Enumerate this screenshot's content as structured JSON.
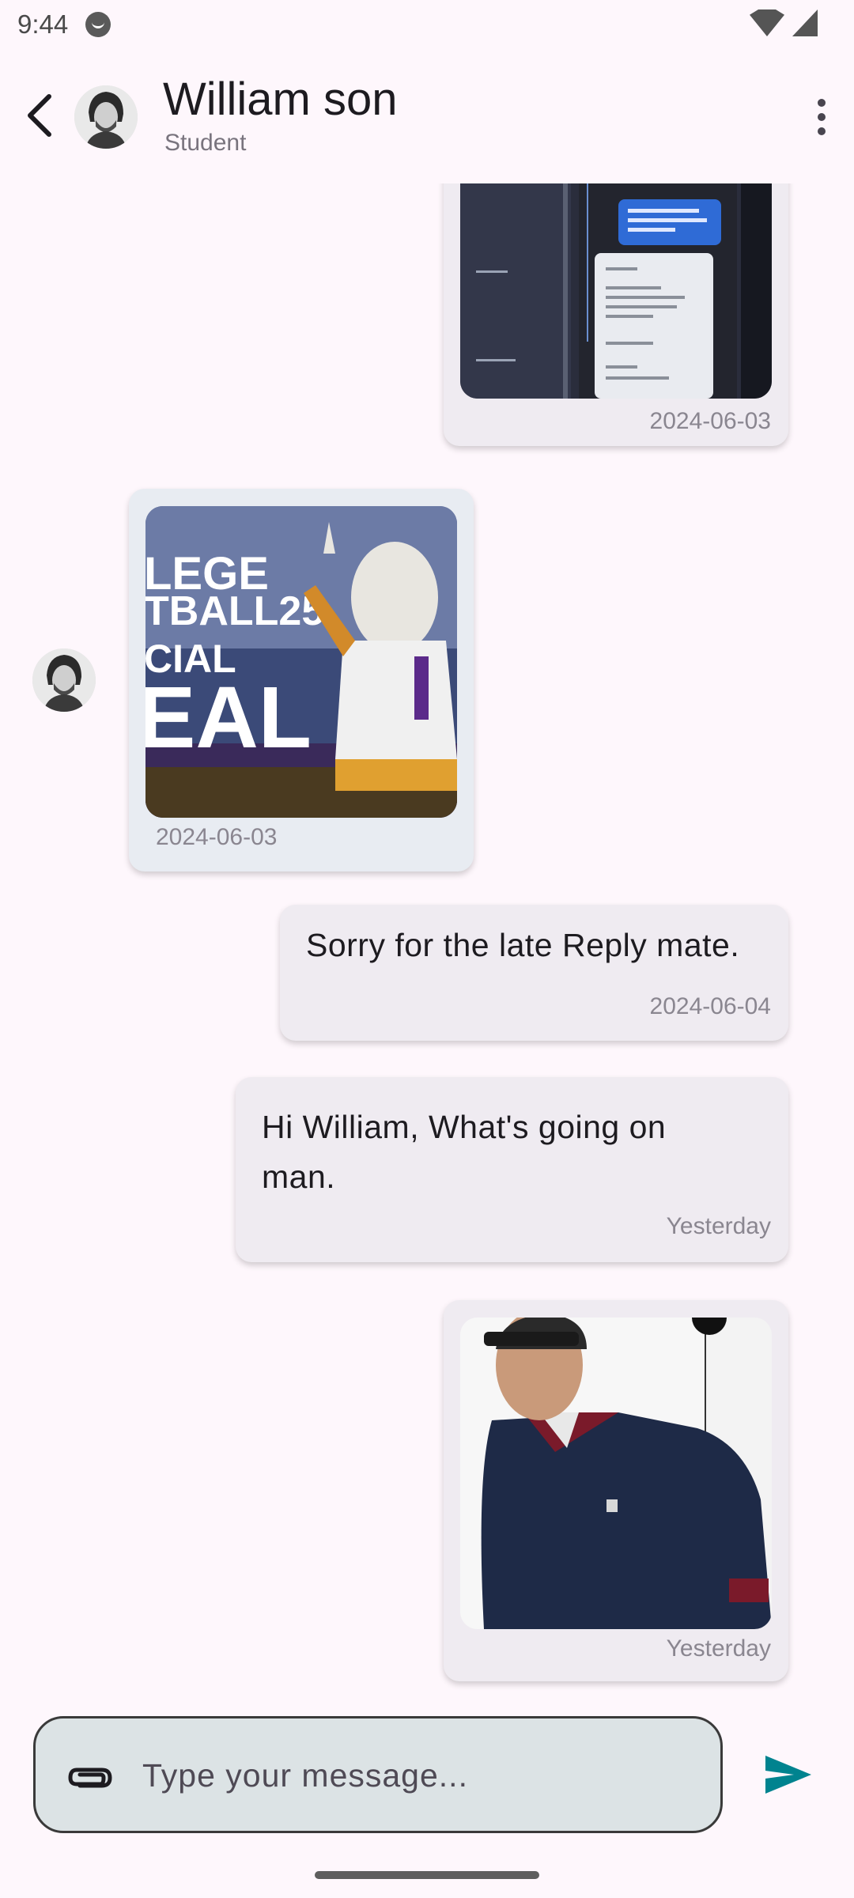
{
  "status_bar": {
    "time": "9:44"
  },
  "header": {
    "contact_name": "William son",
    "contact_role": "Student",
    "back_icon": "arrow-back-icon",
    "menu_icon": "more-vert-icon"
  },
  "messages": [
    {
      "direction": "sent",
      "type": "image",
      "image_description": "screenshot-of-code-chat",
      "timestamp": "2024-06-03"
    },
    {
      "direction": "received",
      "type": "image",
      "image_description": "college-football-25-mascot",
      "timestamp": "2024-06-03"
    },
    {
      "direction": "sent",
      "type": "text",
      "text": "Sorry for the late Reply mate.",
      "timestamp": "2024-06-04"
    },
    {
      "direction": "sent",
      "type": "text",
      "text": "Hi William, What's going on man.",
      "timestamp": "Yesterday"
    },
    {
      "direction": "sent",
      "type": "image",
      "image_description": "man-in-navy-polo",
      "timestamp": "Yesterday"
    }
  ],
  "composer": {
    "placeholder": "Type your message...",
    "value": "",
    "attach_icon": "paperclip-icon",
    "send_icon": "send-icon"
  },
  "colors": {
    "background": "#FEF7FC",
    "sent_bubble": "#EFEBF1",
    "received_bubble": "#E8ECF2",
    "composer_fill": "#DCE3E5",
    "send_accent": "#00838F"
  }
}
